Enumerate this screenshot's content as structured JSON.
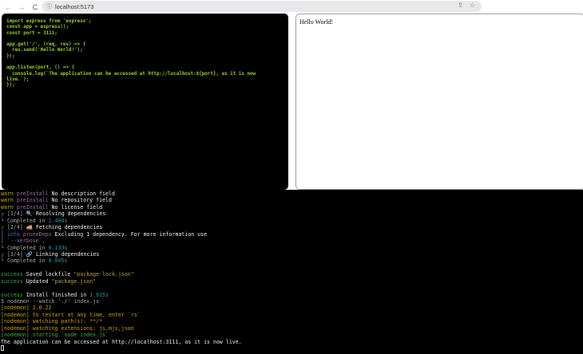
{
  "browser": {
    "url": "localhost:5173",
    "back": "←",
    "forward": "→",
    "reload": "C",
    "info_icon": "ⓘ",
    "share_icon": "⇪",
    "star_icon": "☆"
  },
  "editor": {
    "code": "import express from 'express';\nconst app = express();\nconst port = 3111;\n\napp.get('/', (req, res) => {\n  res.send('Hello World!');\n});\n\napp.listen(port, () => {\n  console.log(`The application can be accessed at http://localhost:${port}, as it is now\nlive.`);\n});"
  },
  "preview": {
    "text": "Hello World!"
  },
  "terminal": {
    "lines": [
      [
        [
          "warn ",
          "c-warn"
        ],
        [
          "preInstall ",
          "c-mag"
        ],
        [
          "No description field",
          "c-white"
        ]
      ],
      [
        [
          "warn ",
          "c-warn"
        ],
        [
          "preInstall ",
          "c-mag"
        ],
        [
          "No repository field",
          "c-white"
        ]
      ],
      [
        [
          "warn ",
          "c-warn"
        ],
        [
          "preInstall ",
          "c-mag"
        ],
        [
          "No license field",
          "c-white"
        ]
      ],
      [
        [
          "┌ ",
          "c-gray"
        ],
        [
          "[1/4] ",
          "c-gray"
        ],
        [
          "🔍 Resolving dependencies",
          "c-white"
        ]
      ],
      [
        [
          "└ ",
          "c-gray"
        ],
        [
          "Completed in ",
          "c-gray"
        ],
        [
          "1.404s",
          "c-cyan"
        ]
      ],
      [
        [
          "┌ ",
          "c-gray"
        ],
        [
          "[2/4] ",
          "c-gray"
        ],
        [
          "🚚 Fetching dependencies",
          "c-white"
        ]
      ],
      [
        [
          "│ ",
          "c-gray"
        ],
        [
          "info ",
          "c-blue"
        ],
        [
          "pruneDeps ",
          "c-mag"
        ],
        [
          "Excluding 1 dependency. For more information use",
          "c-white"
        ]
      ],
      [
        [
          "│ ",
          "c-gray"
        ],
        [
          "`--verbose`",
          "c-mag"
        ],
        [
          ".",
          "c-white"
        ]
      ],
      [
        [
          "└ ",
          "c-gray"
        ],
        [
          "Completed in ",
          "c-gray"
        ],
        [
          "0.133s",
          "c-cyan"
        ]
      ],
      [
        [
          "┌ ",
          "c-gray"
        ],
        [
          "[3/4] ",
          "c-gray"
        ],
        [
          "🔗 Linking dependencies",
          "c-white"
        ]
      ],
      [
        [
          "└ ",
          "c-gray"
        ],
        [
          "Completed in ",
          "c-gray"
        ],
        [
          "0.045s",
          "c-cyan"
        ]
      ],
      [],
      [
        [
          "success ",
          "c-green"
        ],
        [
          "Saved lockfile ",
          "c-white"
        ],
        [
          "\"package-lock.json\"",
          "c-str"
        ]
      ],
      [
        [
          "success ",
          "c-green"
        ],
        [
          "Updated ",
          "c-white"
        ],
        [
          "\"package.json\"",
          "c-str"
        ]
      ],
      [],
      [
        [
          "success ",
          "c-green"
        ],
        [
          "Install finished in ",
          "c-white"
        ],
        [
          "1.615s",
          "c-cyan"
        ]
      ],
      [
        [
          "$ nodemon --watch './' index.js",
          "c-gray"
        ]
      ],
      [
        [
          "[nodemon] 2.0.22",
          "c-yel"
        ]
      ],
      [
        [
          "[nodemon] to restart at any time, enter `rs`",
          "c-yel"
        ]
      ],
      [
        [
          "[nodemon] watching path(s): **/*",
          "c-yel"
        ]
      ],
      [
        [
          "[nodemon] watching extensions: js,mjs,json",
          "c-yel"
        ]
      ],
      [
        [
          "[nodemon] starting `node index.js`",
          "c-green"
        ]
      ],
      [
        [
          "The application can be accessed at http://localhost:3111, as it is now live.",
          "c-white"
        ]
      ]
    ]
  }
}
